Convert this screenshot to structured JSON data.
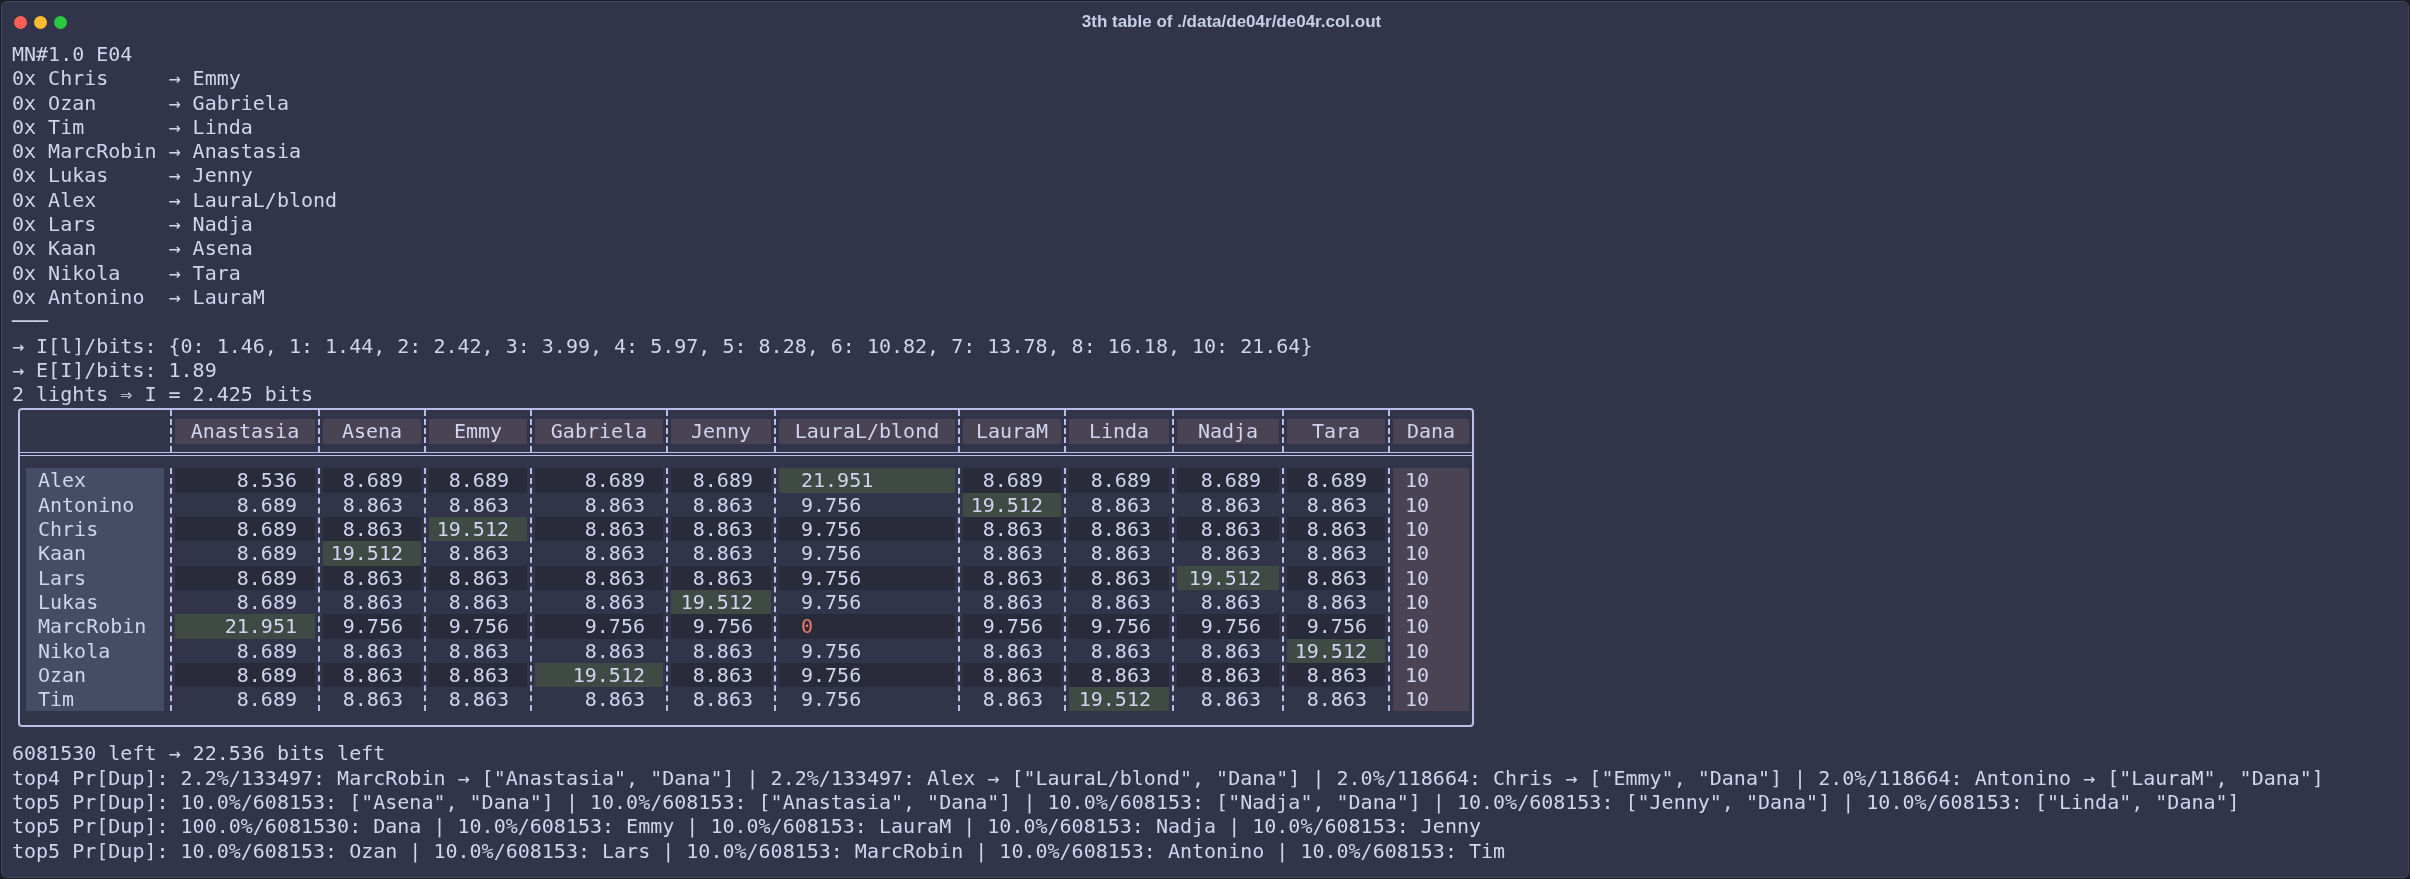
{
  "window": {
    "title": "3th table of ./data/de04r/de04r.col.out"
  },
  "header_lines": [
    "MN#1.0 E04",
    "0x Chris     → Emmy",
    "0x Ozan      → Gabriela",
    "0x Tim       → Linda",
    "0x MarcRobin → Anastasia",
    "0x Lukas     → Jenny",
    "0x Alex      → LauraL/blond",
    "0x Lars      → Nadja",
    "0x Kaan      → Asena",
    "0x Nikola    → Tara",
    "0x Antonino  → LauraM",
    "───",
    "→ I[l]/bits: {0: 1.46, 1: 1.44, 2: 2.42, 3: 3.99, 4: 5.97, 5: 8.28, 6: 10.82, 7: 13.78, 8: 16.18, 10: 21.64}",
    "→ E[I]/bits: 1.89",
    "2 lights ⇒ I = 2.425 bits"
  ],
  "table": {
    "columns": [
      "Anastasia",
      "Asena",
      "Emmy",
      "Gabriela",
      "Jenny",
      "LauraL/blond",
      "LauraM",
      "Linda",
      "Nadja",
      "Tara",
      "Dana"
    ],
    "rows": [
      {
        "name": "Alex",
        "cells": [
          {
            "value": "8.536",
            "kind": "normal"
          },
          {
            "value": "8.689",
            "kind": "normal"
          },
          {
            "value": "8.689",
            "kind": "normal"
          },
          {
            "value": "8.689",
            "kind": "normal"
          },
          {
            "value": "8.689",
            "kind": "normal"
          },
          {
            "value": "21.951",
            "kind": "match"
          },
          {
            "value": "8.689",
            "kind": "normal"
          },
          {
            "value": "8.689",
            "kind": "normal"
          },
          {
            "value": "8.689",
            "kind": "normal"
          },
          {
            "value": "8.689",
            "kind": "normal"
          },
          {
            "value": "10",
            "kind": "fixed"
          }
        ]
      },
      {
        "name": "Antonino",
        "cells": [
          {
            "value": "8.689",
            "kind": "normal"
          },
          {
            "value": "8.863",
            "kind": "normal"
          },
          {
            "value": "8.863",
            "kind": "normal"
          },
          {
            "value": "8.863",
            "kind": "normal"
          },
          {
            "value": "8.863",
            "kind": "normal"
          },
          {
            "value": "9.756",
            "kind": "normal"
          },
          {
            "value": "19.512",
            "kind": "match"
          },
          {
            "value": "8.863",
            "kind": "normal"
          },
          {
            "value": "8.863",
            "kind": "normal"
          },
          {
            "value": "8.863",
            "kind": "normal"
          },
          {
            "value": "10",
            "kind": "fixed"
          }
        ]
      },
      {
        "name": "Chris",
        "cells": [
          {
            "value": "8.689",
            "kind": "normal"
          },
          {
            "value": "8.863",
            "kind": "normal"
          },
          {
            "value": "19.512",
            "kind": "match"
          },
          {
            "value": "8.863",
            "kind": "normal"
          },
          {
            "value": "8.863",
            "kind": "normal"
          },
          {
            "value": "9.756",
            "kind": "normal"
          },
          {
            "value": "8.863",
            "kind": "normal"
          },
          {
            "value": "8.863",
            "kind": "normal"
          },
          {
            "value": "8.863",
            "kind": "normal"
          },
          {
            "value": "8.863",
            "kind": "normal"
          },
          {
            "value": "10",
            "kind": "fixed"
          }
        ]
      },
      {
        "name": "Kaan",
        "cells": [
          {
            "value": "8.689",
            "kind": "normal"
          },
          {
            "value": "19.512",
            "kind": "match"
          },
          {
            "value": "8.863",
            "kind": "normal"
          },
          {
            "value": "8.863",
            "kind": "normal"
          },
          {
            "value": "8.863",
            "kind": "normal"
          },
          {
            "value": "9.756",
            "kind": "normal"
          },
          {
            "value": "8.863",
            "kind": "normal"
          },
          {
            "value": "8.863",
            "kind": "normal"
          },
          {
            "value": "8.863",
            "kind": "normal"
          },
          {
            "value": "8.863",
            "kind": "normal"
          },
          {
            "value": "10",
            "kind": "fixed"
          }
        ]
      },
      {
        "name": "Lars",
        "cells": [
          {
            "value": "8.689",
            "kind": "normal"
          },
          {
            "value": "8.863",
            "kind": "normal"
          },
          {
            "value": "8.863",
            "kind": "normal"
          },
          {
            "value": "8.863",
            "kind": "normal"
          },
          {
            "value": "8.863",
            "kind": "normal"
          },
          {
            "value": "9.756",
            "kind": "normal"
          },
          {
            "value": "8.863",
            "kind": "normal"
          },
          {
            "value": "8.863",
            "kind": "normal"
          },
          {
            "value": "19.512",
            "kind": "match"
          },
          {
            "value": "8.863",
            "kind": "normal"
          },
          {
            "value": "10",
            "kind": "fixed"
          }
        ]
      },
      {
        "name": "Lukas",
        "cells": [
          {
            "value": "8.689",
            "kind": "normal"
          },
          {
            "value": "8.863",
            "kind": "normal"
          },
          {
            "value": "8.863",
            "kind": "normal"
          },
          {
            "value": "8.863",
            "kind": "normal"
          },
          {
            "value": "19.512",
            "kind": "match"
          },
          {
            "value": "9.756",
            "kind": "normal"
          },
          {
            "value": "8.863",
            "kind": "normal"
          },
          {
            "value": "8.863",
            "kind": "normal"
          },
          {
            "value": "8.863",
            "kind": "normal"
          },
          {
            "value": "8.863",
            "kind": "normal"
          },
          {
            "value": "10",
            "kind": "fixed"
          }
        ]
      },
      {
        "name": "MarcRobin",
        "cells": [
          {
            "value": "21.951",
            "kind": "match"
          },
          {
            "value": "9.756",
            "kind": "normal"
          },
          {
            "value": "9.756",
            "kind": "normal"
          },
          {
            "value": "9.756",
            "kind": "normal"
          },
          {
            "value": "9.756",
            "kind": "normal"
          },
          {
            "value": "0",
            "kind": "zero"
          },
          {
            "value": "9.756",
            "kind": "normal"
          },
          {
            "value": "9.756",
            "kind": "normal"
          },
          {
            "value": "9.756",
            "kind": "normal"
          },
          {
            "value": "9.756",
            "kind": "normal"
          },
          {
            "value": "10",
            "kind": "fixed"
          }
        ]
      },
      {
        "name": "Nikola",
        "cells": [
          {
            "value": "8.689",
            "kind": "normal"
          },
          {
            "value": "8.863",
            "kind": "normal"
          },
          {
            "value": "8.863",
            "kind": "normal"
          },
          {
            "value": "8.863",
            "kind": "normal"
          },
          {
            "value": "8.863",
            "kind": "normal"
          },
          {
            "value": "9.756",
            "kind": "normal"
          },
          {
            "value": "8.863",
            "kind": "normal"
          },
          {
            "value": "8.863",
            "kind": "normal"
          },
          {
            "value": "8.863",
            "kind": "normal"
          },
          {
            "value": "19.512",
            "kind": "match"
          },
          {
            "value": "10",
            "kind": "fixed"
          }
        ]
      },
      {
        "name": "Ozan",
        "cells": [
          {
            "value": "8.689",
            "kind": "normal"
          },
          {
            "value": "8.863",
            "kind": "normal"
          },
          {
            "value": "8.863",
            "kind": "normal"
          },
          {
            "value": "19.512",
            "kind": "match"
          },
          {
            "value": "8.863",
            "kind": "normal"
          },
          {
            "value": "9.756",
            "kind": "normal"
          },
          {
            "value": "8.863",
            "kind": "normal"
          },
          {
            "value": "8.863",
            "kind": "normal"
          },
          {
            "value": "8.863",
            "kind": "normal"
          },
          {
            "value": "8.863",
            "kind": "normal"
          },
          {
            "value": "10",
            "kind": "fixed"
          }
        ]
      },
      {
        "name": "Tim",
        "cells": [
          {
            "value": "8.689",
            "kind": "normal"
          },
          {
            "value": "8.863",
            "kind": "normal"
          },
          {
            "value": "8.863",
            "kind": "normal"
          },
          {
            "value": "8.863",
            "kind": "normal"
          },
          {
            "value": "8.863",
            "kind": "normal"
          },
          {
            "value": "9.756",
            "kind": "normal"
          },
          {
            "value": "8.863",
            "kind": "normal"
          },
          {
            "value": "19.512",
            "kind": "match"
          },
          {
            "value": "8.863",
            "kind": "normal"
          },
          {
            "value": "8.863",
            "kind": "normal"
          },
          {
            "value": "10",
            "kind": "fixed"
          }
        ]
      }
    ]
  },
  "footer_lines": [
    "6081530 left → 22.536 bits left",
    "top4 Pr[Dup]: 2.2%/133497: MarcRobin → [\"Anastasia\", \"Dana\"] | 2.2%/133497: Alex → [\"LauraL/blond\", \"Dana\"] | 2.0%/118664: Chris → [\"Emmy\", \"Dana\"] | 2.0%/118664: Antonino → [\"LauraM\", \"Dana\"]",
    "top5 Pr[Dup]: 10.0%/608153: [\"Asena\", \"Dana\"] | 10.0%/608153: [\"Anastasia\", \"Dana\"] | 10.0%/608153: [\"Nadja\", \"Dana\"] | 10.0%/608153: [\"Jenny\", \"Dana\"] | 10.0%/608153: [\"Linda\", \"Dana\"]",
    "top5 Pr[Dup]: 100.0%/6081530: Dana | 10.0%/608153: Emmy | 10.0%/608153: LauraM | 10.0%/608153: Nadja | 10.0%/608153: Jenny",
    "top5 Pr[Dup]: 10.0%/608153: Ozan | 10.0%/608153: Lars | 10.0%/608153: MarcRobin | 10.0%/608153: Antonino | 10.0%/608153: Tim"
  ]
}
